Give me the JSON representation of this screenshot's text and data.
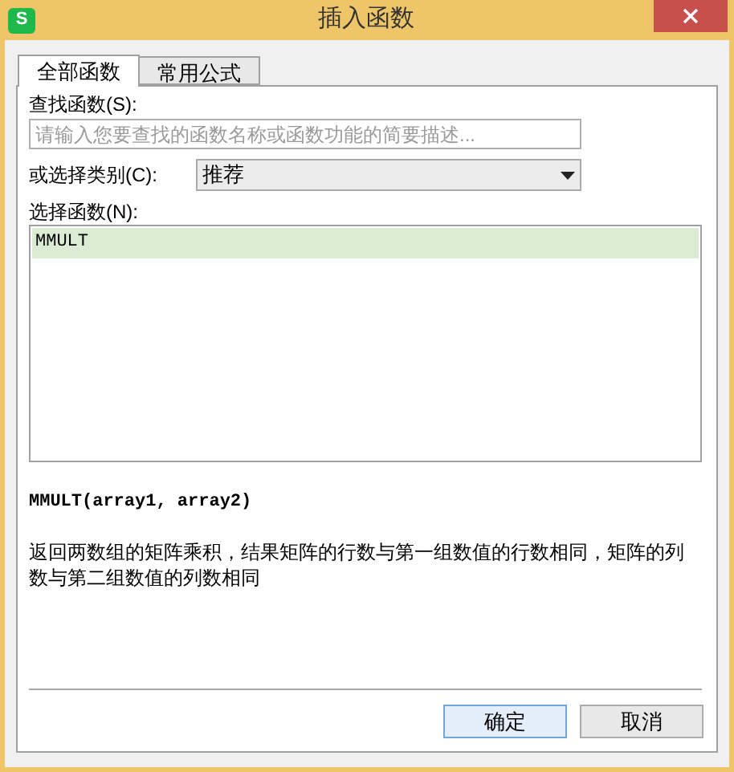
{
  "window": {
    "title": "插入函数",
    "app_icon": "S"
  },
  "tabs": [
    {
      "label": "全部函数",
      "selected": true
    },
    {
      "label": "常用公式",
      "selected": false
    }
  ],
  "search": {
    "label": "查找函数(S):",
    "placeholder": "请输入您要查找的函数名称或函数功能的简要描述..."
  },
  "category": {
    "label": "或选择类别(C):",
    "value": "推荐"
  },
  "functions": {
    "label": "选择函数(N):",
    "items": [
      {
        "name": "MMULT",
        "selected": true
      }
    ]
  },
  "signature": "MMULT(array1, array2)",
  "description": "返回两数组的矩阵乘积，结果矩阵的行数与第一组数值的行数相同，矩阵的列数与第二组数值的列数相同",
  "buttons": [
    {
      "label": "确定",
      "kind": "default"
    },
    {
      "label": "取消",
      "kind": "normal"
    }
  ]
}
